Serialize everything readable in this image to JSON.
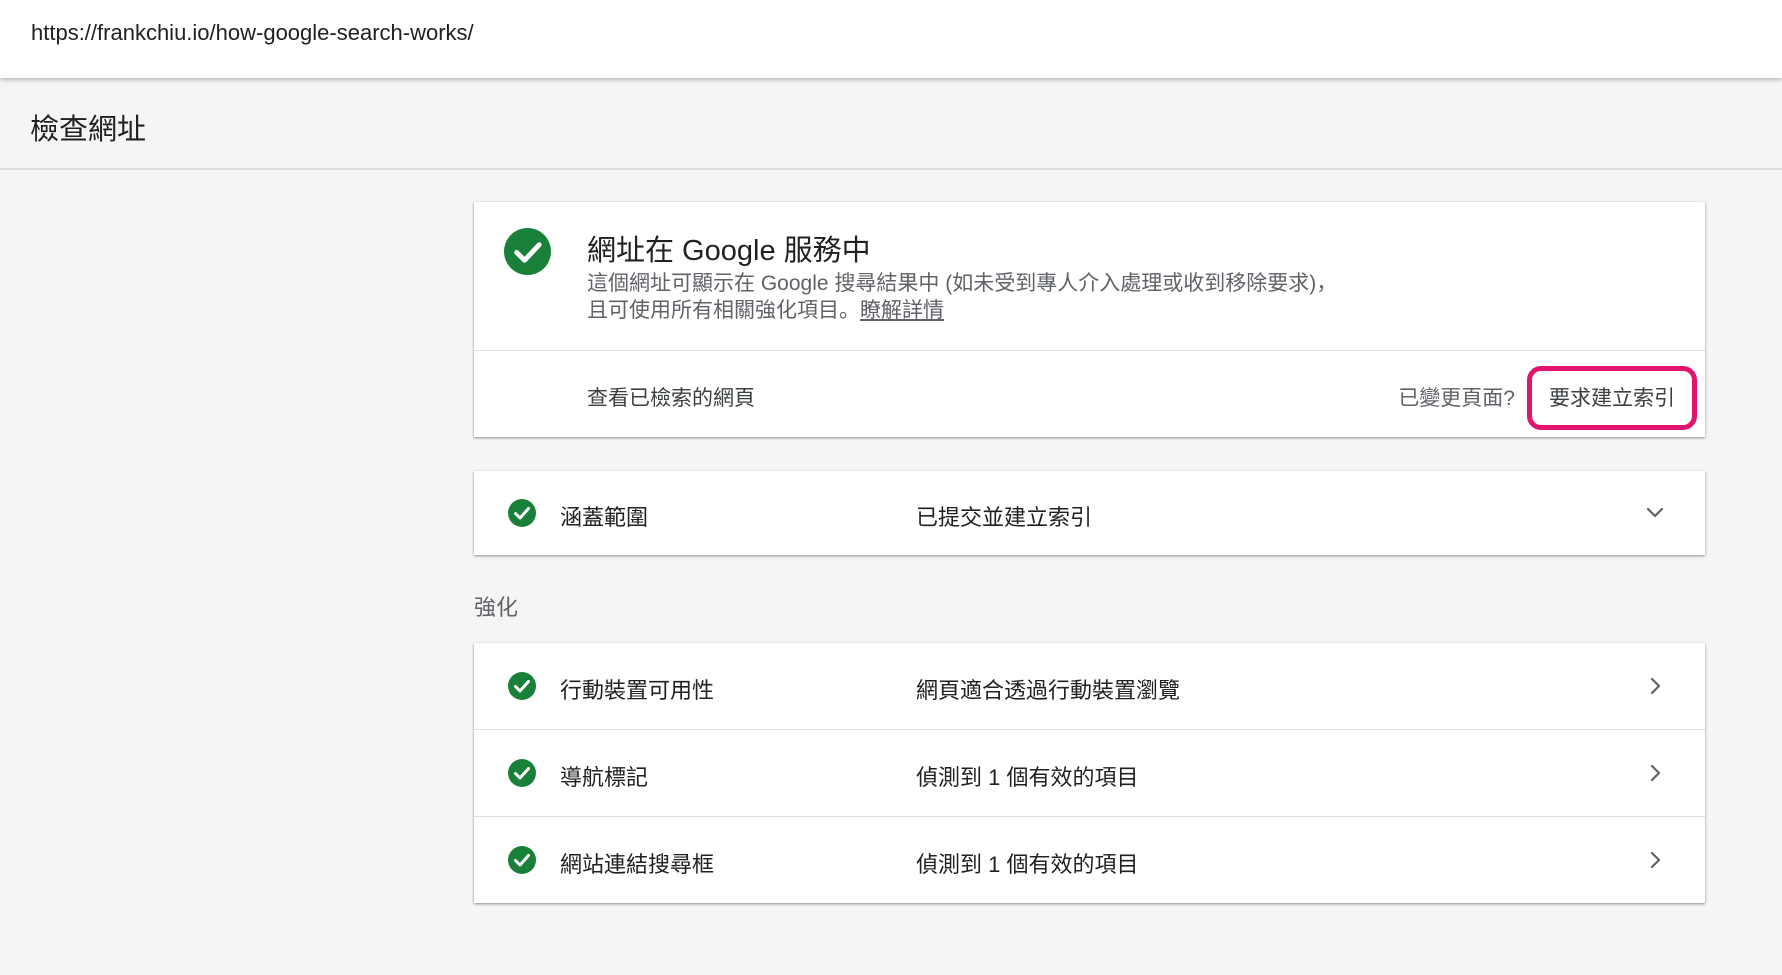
{
  "address_bar": {
    "url": "https://frankchiu.io/how-google-search-works/"
  },
  "page": {
    "title": "檢查網址"
  },
  "status_card": {
    "title": "網址在 Google 服務中",
    "description_line1": "這個網址可顯示在 Google 搜尋結果中 (如未受到專人介入處理或收到移除要求)，",
    "description_line2": "且可使用所有相關強化項目。",
    "learn_more": "瞭解詳情",
    "view_indexed_page": "查看已檢索的網頁",
    "page_changed_question": "已變更頁面?",
    "request_indexing": "要求建立索引",
    "icon": "check-circle-icon",
    "status_color": "#188038",
    "highlight_color": "#e3146e"
  },
  "coverage": {
    "label": "涵蓋範圍",
    "value": "已提交並建立索引",
    "icon": "chevron-down-icon"
  },
  "enhancements": {
    "section_title": "強化",
    "items": [
      {
        "label": "行動裝置可用性",
        "value": "網頁適合透過行動裝置瀏覽"
      },
      {
        "label": "導航標記",
        "value": "偵測到 1 個有效的項目"
      },
      {
        "label": "網站連結搜尋框",
        "value": "偵測到 1 個有效的項目"
      }
    ]
  }
}
